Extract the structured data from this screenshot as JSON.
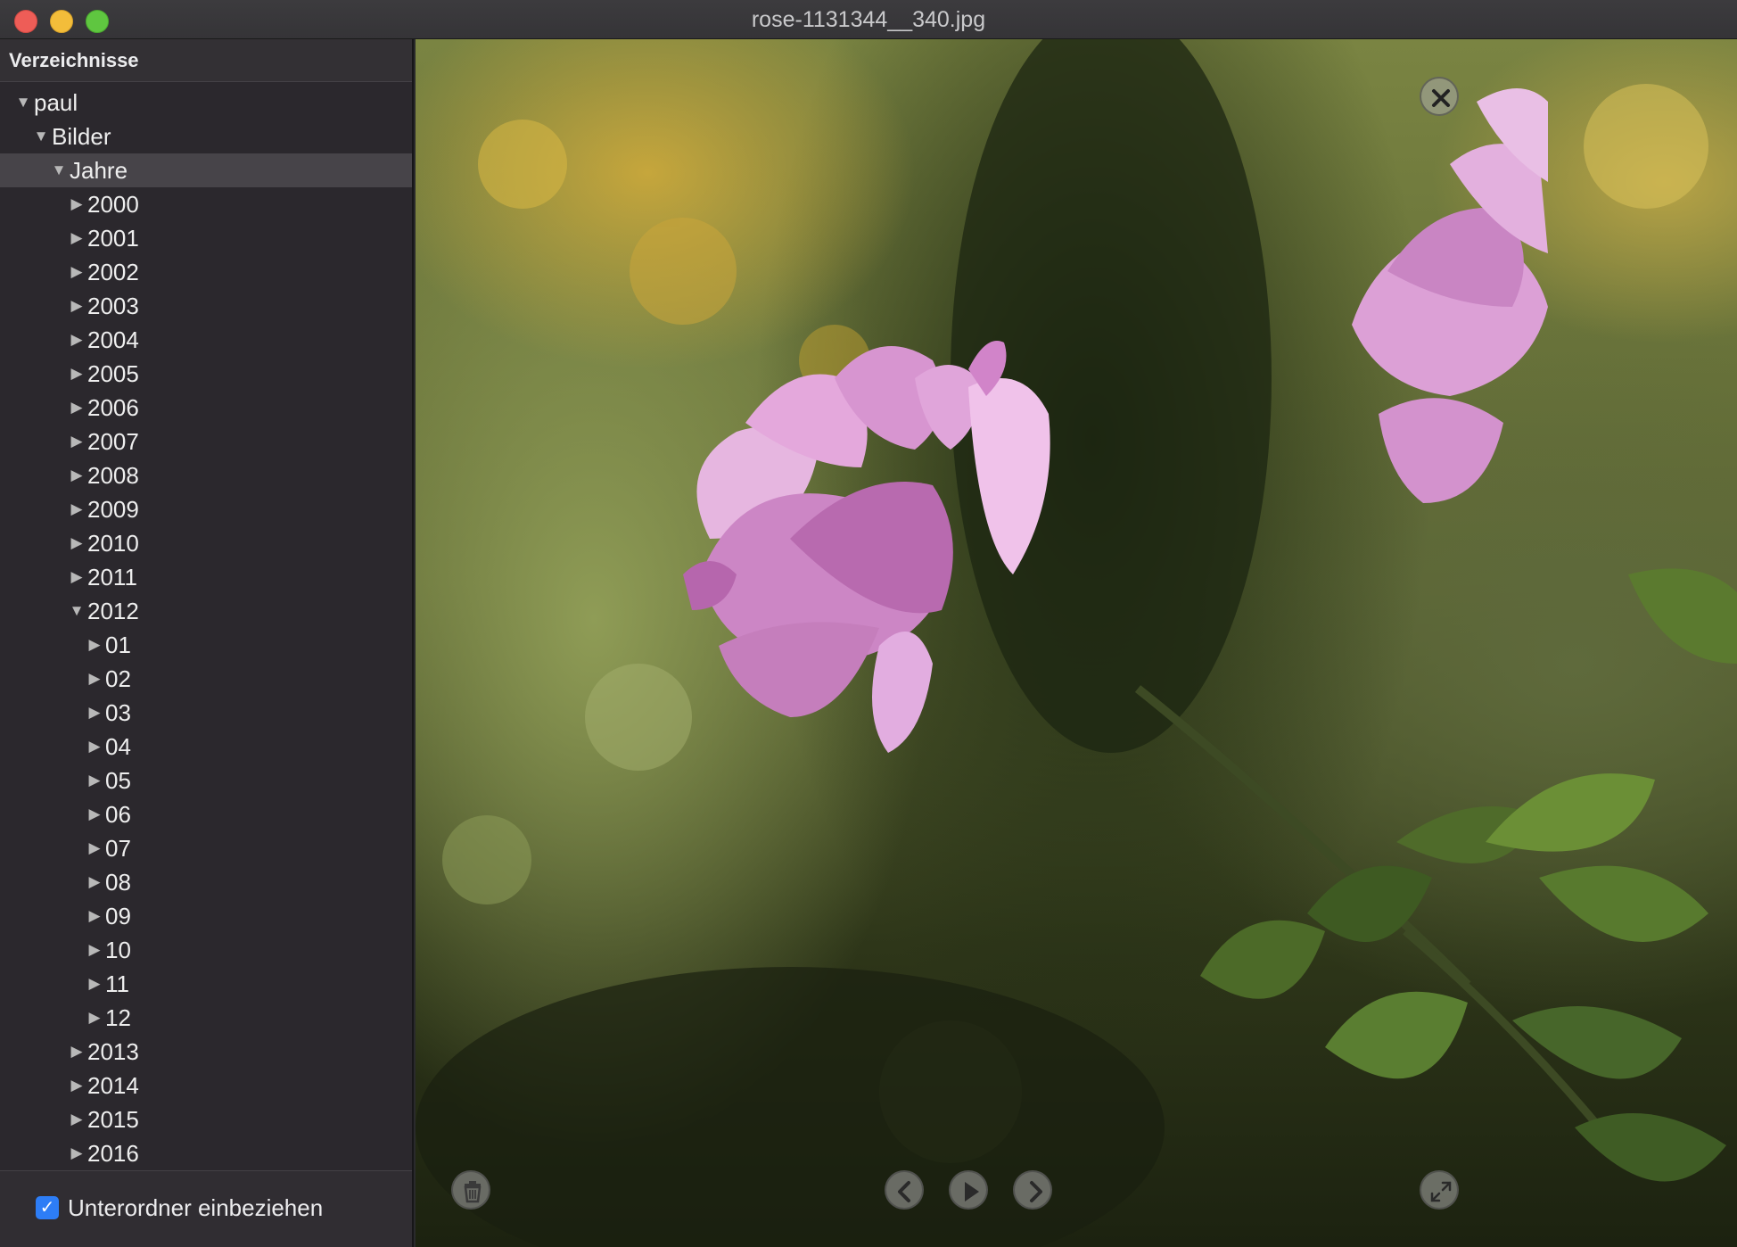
{
  "window": {
    "title": "rose-1131344__340.jpg"
  },
  "sidebar": {
    "header": "Verzeichnisse",
    "tree": [
      {
        "label": "paul",
        "level": 0,
        "expanded": true
      },
      {
        "label": "Bilder",
        "level": 1,
        "expanded": true
      },
      {
        "label": "Jahre",
        "level": 2,
        "expanded": true,
        "selected": true
      },
      {
        "label": "2000",
        "level": 3,
        "expanded": false
      },
      {
        "label": "2001",
        "level": 3,
        "expanded": false
      },
      {
        "label": "2002",
        "level": 3,
        "expanded": false
      },
      {
        "label": "2003",
        "level": 3,
        "expanded": false
      },
      {
        "label": "2004",
        "level": 3,
        "expanded": false
      },
      {
        "label": "2005",
        "level": 3,
        "expanded": false
      },
      {
        "label": "2006",
        "level": 3,
        "expanded": false
      },
      {
        "label": "2007",
        "level": 3,
        "expanded": false
      },
      {
        "label": "2008",
        "level": 3,
        "expanded": false
      },
      {
        "label": "2009",
        "level": 3,
        "expanded": false
      },
      {
        "label": "2010",
        "level": 3,
        "expanded": false
      },
      {
        "label": "2011",
        "level": 3,
        "expanded": false
      },
      {
        "label": "2012",
        "level": 3,
        "expanded": true
      },
      {
        "label": "01",
        "level": 4,
        "expanded": false
      },
      {
        "label": "02",
        "level": 4,
        "expanded": false
      },
      {
        "label": "03",
        "level": 4,
        "expanded": false
      },
      {
        "label": "04",
        "level": 4,
        "expanded": false
      },
      {
        "label": "05",
        "level": 4,
        "expanded": false
      },
      {
        "label": "06",
        "level": 4,
        "expanded": false
      },
      {
        "label": "07",
        "level": 4,
        "expanded": false
      },
      {
        "label": "08",
        "level": 4,
        "expanded": false
      },
      {
        "label": "09",
        "level": 4,
        "expanded": false
      },
      {
        "label": "10",
        "level": 4,
        "expanded": false
      },
      {
        "label": "11",
        "level": 4,
        "expanded": false
      },
      {
        "label": "12",
        "level": 4,
        "expanded": false
      },
      {
        "label": "2013",
        "level": 3,
        "expanded": false
      },
      {
        "label": "2014",
        "level": 3,
        "expanded": false
      },
      {
        "label": "2015",
        "level": 3,
        "expanded": false
      },
      {
        "label": "2016",
        "level": 3,
        "expanded": false
      }
    ],
    "footer": {
      "checkbox_label": "Unterordner einbeziehen",
      "checked": true
    }
  },
  "viewer": {
    "controls": {
      "close": "close-icon",
      "trash": "trash-icon",
      "previous": "chevron-left-icon",
      "play": "play-icon",
      "next": "chevron-right-icon",
      "fullscreen": "expand-icon"
    }
  },
  "colors": {
    "close": "#ee5d57",
    "minimize": "#f3bd3a",
    "maximize": "#5fc640",
    "accent": "#2d7df6",
    "rose": "#d79ad3"
  }
}
